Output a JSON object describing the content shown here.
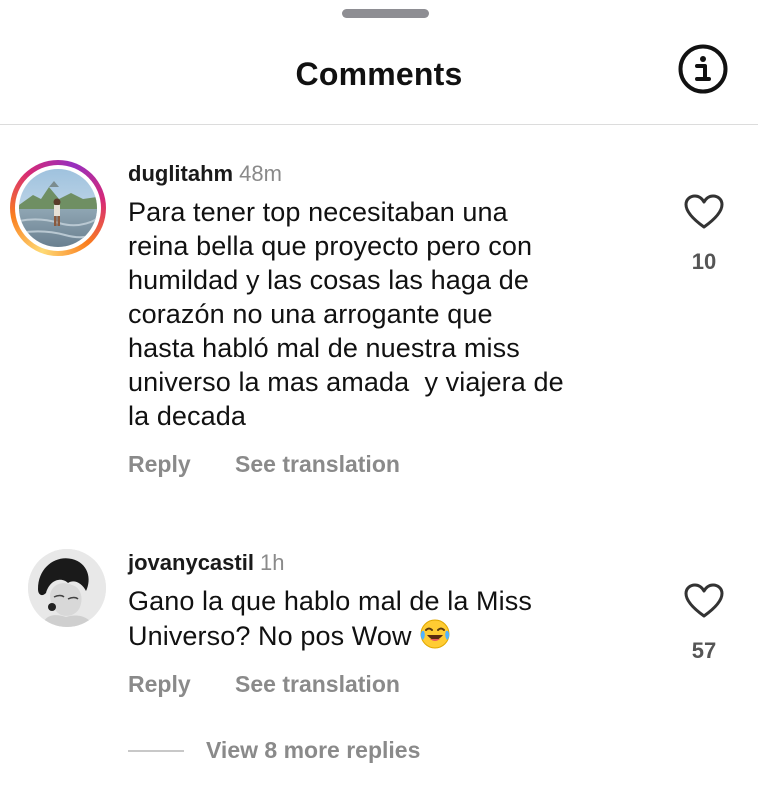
{
  "header": {
    "title": "Comments",
    "info_icon": "info-circle-icon"
  },
  "comments": [
    {
      "username": "duglitahm",
      "time": "48m",
      "text_lines": [
        "Para tener top necesitaban una",
        "reina bella que proyecto pero con",
        "humildad y las cosas las haga de",
        "corazón no una arrogante que",
        "hasta habló mal de nuestra miss",
        "universo la mas amada  y viajera de",
        "la decada"
      ],
      "reply_label": "Reply",
      "translate_label": "See translation",
      "likes": "10",
      "has_story_ring": true
    },
    {
      "username": "jovanycastil",
      "time": "1h",
      "text_lines": [
        "Gano la que hablo mal de la Miss",
        "Universo? No pos Wow"
      ],
      "emoji": "face-with-tears-of-joy",
      "reply_label": "Reply",
      "translate_label": "See translation",
      "likes": "57",
      "has_story_ring": false
    }
  ],
  "view_replies_label": "View 8 more replies",
  "colors": {
    "text": "#111111",
    "muted": "#8a8a8a",
    "divider": "#dcdcdc",
    "story_ring": [
      "#feda75",
      "#fa7e1e",
      "#d62976",
      "#962fbf"
    ]
  }
}
